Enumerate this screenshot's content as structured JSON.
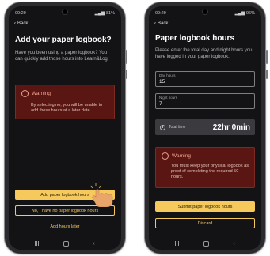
{
  "left_screen": {
    "status": {
      "time": "09:29",
      "battery": "81%"
    },
    "back_label": "Back",
    "title": "Add your paper logbook?",
    "description": "Have you been using a paper logbook? You can quickly add those hours into Learn&Log.",
    "warning": {
      "title": "Warning",
      "text": "By selecting no, you will be unable to add these hours at a later date."
    },
    "buttons": {
      "primary": "Add paper logbook hours",
      "secondary": "No, I have no paper logbook hours",
      "tertiary": "Add hours later"
    }
  },
  "right_screen": {
    "status": {
      "time": "09:29",
      "battery": "96%"
    },
    "back_label": "Back",
    "title": "Paper logbook hours",
    "description": "Please enter the total day and night hours you have logged in your paper logbook.",
    "day_field": {
      "label": "Day hours",
      "value": "15"
    },
    "night_field": {
      "label": "Night hours",
      "value": "7"
    },
    "total": {
      "label": "Total time",
      "value": "22hr 0min"
    },
    "warning": {
      "title": "Warning",
      "text": "You must keep your physical logbook as proof of completing the required 50 hours."
    },
    "buttons": {
      "primary": "Submit paper logbook hours",
      "secondary": "Discard"
    }
  },
  "colors": {
    "accent": "#f5c95c",
    "background": "#131316",
    "warning_bg": "#5a1612"
  },
  "icons": [
    "back-chevron-icon",
    "warning-icon",
    "clock-icon",
    "hand-pointer-icon"
  ]
}
